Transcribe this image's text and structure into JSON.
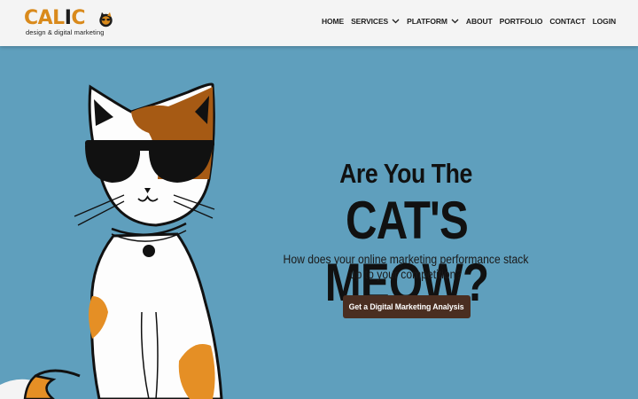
{
  "logo": {
    "word_a": "CAL",
    "word_b": "I",
    "word_c": "C",
    "tagline": "design & digital marketing",
    "brand_colors": {
      "orange": "#d98a1c",
      "dark": "#1c1c1c"
    }
  },
  "nav": {
    "items": [
      {
        "label": "HOME",
        "dropdown": false
      },
      {
        "label": "SERVICES",
        "dropdown": true,
        "icon": "chevron-down-icon"
      },
      {
        "label": "PLATFORM",
        "dropdown": true,
        "icon": "chevron-down-icon"
      },
      {
        "label": "ABOUT",
        "dropdown": false
      },
      {
        "label": "PORTFOLIO",
        "dropdown": false
      },
      {
        "label": "CONTACT",
        "dropdown": false
      },
      {
        "label": "LOGIN",
        "dropdown": false
      }
    ]
  },
  "hero": {
    "headline_line1": "Are You The",
    "headline_line2": "CAT'S MEOW?",
    "subtext": "How does your online marketing performance stack up to your competition?",
    "cta_label": "Get a Digital Marketing Analysis",
    "background_color": "#5f9fbd",
    "cta_color": "#4a2e21"
  }
}
